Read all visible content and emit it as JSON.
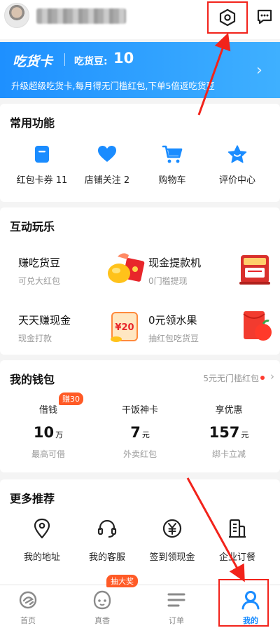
{
  "header": {
    "settings_icon": "hexagon-settings-icon",
    "message_icon": "chat-bubble-icon"
  },
  "card": {
    "name": "吃货卡",
    "bean_label": "吃货豆:",
    "bean_value": "10",
    "desc": "升级超级吃货卡,每月得无门槛红包,下单5倍返吃货豆",
    "accent": "#1e90ff"
  },
  "common": {
    "title": "常用功能",
    "items": [
      {
        "label": "红包卡券 11",
        "icon": "coupon-icon"
      },
      {
        "label": "店铺关注 2",
        "icon": "heart-icon"
      },
      {
        "label": "购物车",
        "icon": "cart-icon"
      },
      {
        "label": "评价中心",
        "icon": "star-icon"
      }
    ]
  },
  "games": {
    "title": "互动玩乐",
    "items": [
      {
        "title": "赚吃货豆",
        "sub": "可兑大红包"
      },
      {
        "title": "现金提款机",
        "sub": "0门槛提现"
      },
      {
        "title": "天天赚现金",
        "sub": "现金打款",
        "art_text": "¥20"
      },
      {
        "title": "0元领水果",
        "sub": "抽红包吃货豆"
      }
    ]
  },
  "wallet": {
    "title": "我的钱包",
    "promo": "5元无门槛红包",
    "earn_badge": "赚30",
    "items": [
      {
        "name": "借钱",
        "value": "10",
        "unit": "万",
        "sub": "最高可借"
      },
      {
        "name": "干饭神卡",
        "value": "7",
        "unit": "元",
        "sub": "外卖红包"
      },
      {
        "name": "享优惠",
        "value": "157",
        "unit": "元",
        "sub": "绑卡立减"
      }
    ]
  },
  "more": {
    "title": "更多推荐",
    "lottery_badge": "抽大奖",
    "items": [
      {
        "label": "我的地址",
        "icon": "location-pin-icon"
      },
      {
        "label": "我的客服",
        "icon": "headset-icon"
      },
      {
        "label": "签到领现金",
        "icon": "yen-coin-icon"
      },
      {
        "label": "企业订餐",
        "icon": "building-icon"
      }
    ]
  },
  "tabbar": {
    "items": [
      {
        "label": "首页",
        "icon": "home-logo-icon"
      },
      {
        "label": "真香",
        "icon": "fragrance-face-icon"
      },
      {
        "label": "订单",
        "icon": "order-list-icon"
      },
      {
        "label": "我的",
        "icon": "person-icon",
        "active": true
      }
    ]
  }
}
